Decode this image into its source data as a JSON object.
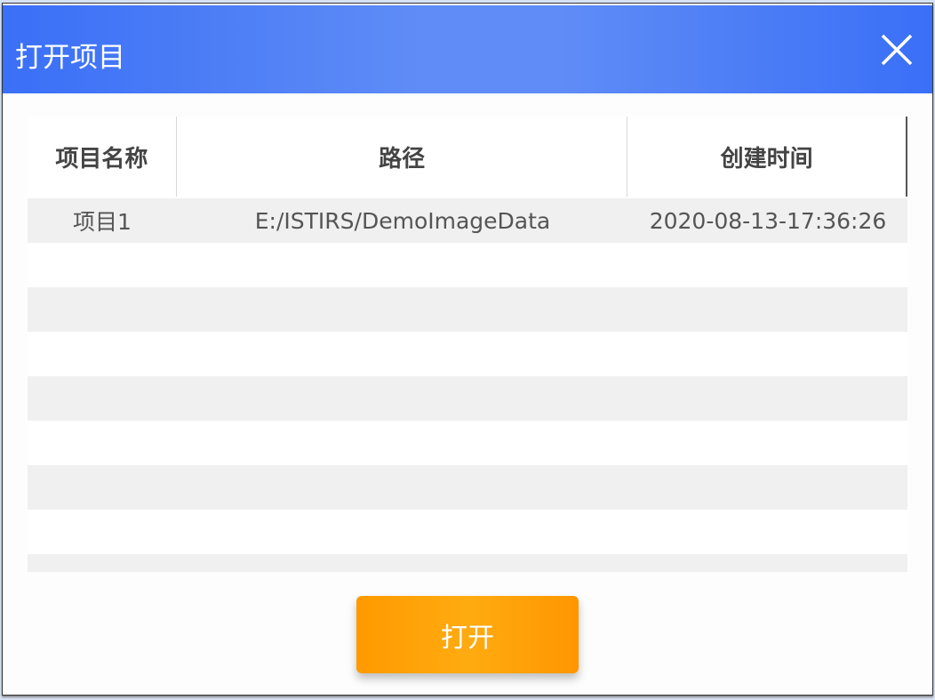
{
  "dialog": {
    "title": "打开项目",
    "close_icon": "close-icon"
  },
  "table": {
    "columns": [
      "项目名称",
      "路径",
      "创建时间"
    ],
    "rows": [
      {
        "name": "项目1",
        "path": "E:/ISTIRS/DemoImageData",
        "created": "2020-08-13-17:36:26"
      }
    ]
  },
  "footer": {
    "open_label": "打开"
  },
  "colors": {
    "title_bar": "#3a6ff7",
    "button": "#ff9a00"
  }
}
